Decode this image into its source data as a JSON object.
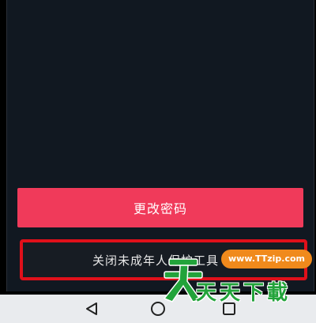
{
  "buttons": {
    "change_password": "更改密码",
    "close_minor_mode": "关闭未成年人保护工具"
  },
  "navbar": {
    "back_icon": "back-triangle-icon",
    "home_icon": "home-circle-icon",
    "recent_icon": "recent-apps-square-icon"
  },
  "watermark": {
    "url": "www.TTzip.com",
    "text": "天天下載"
  },
  "colors": {
    "primary_button": "#f03a5a",
    "highlight_border": "#e0101a",
    "background": "#111821",
    "navbar": "#e9ebee",
    "watermark_green": "#22a33a",
    "watermark_orange": "#f08a1c"
  }
}
